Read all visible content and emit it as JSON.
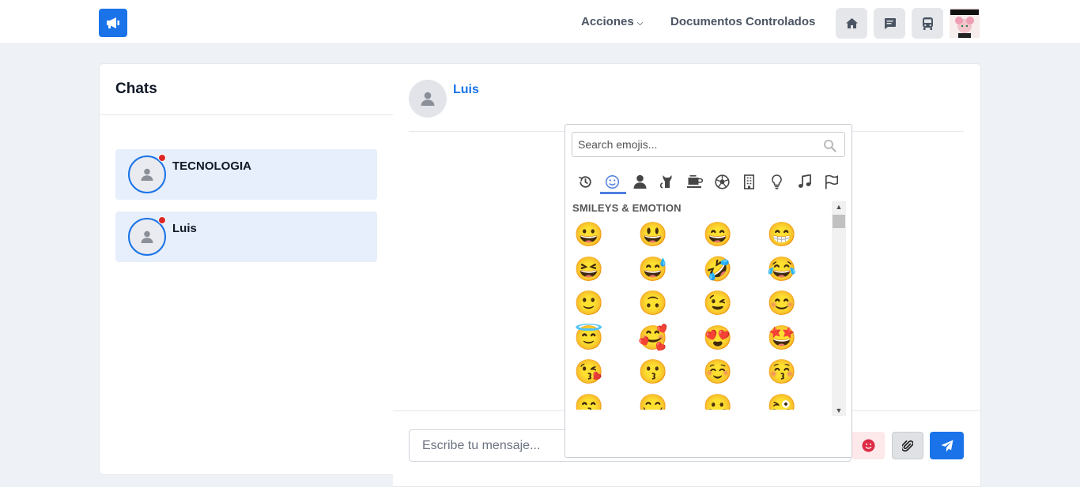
{
  "nav": {
    "acciones": "Acciones",
    "documentos": "Documentos Controlados"
  },
  "chats": {
    "title": "Chats",
    "items": [
      {
        "name": "TECNOLOGIA"
      },
      {
        "name": "Luis"
      }
    ]
  },
  "conversation": {
    "contact_name": "Luis",
    "input_placeholder": "Escribe tu mensaje..."
  },
  "emoji_picker": {
    "search_placeholder": "Search emojis...",
    "categories": [
      "recent",
      "smileys",
      "people",
      "animals",
      "food",
      "activities",
      "travel",
      "objects",
      "symbols",
      "flags"
    ],
    "active_category": "smileys",
    "section_title": "SMILEYS & EMOTION",
    "emojis": [
      "😀",
      "😃",
      "😄",
      "😁",
      "😆",
      "😅",
      "🤣",
      "😂",
      "🙂",
      "🙃",
      "😉",
      "😊",
      "😇",
      "🥰",
      "😍",
      "🤩",
      "😘",
      "😗",
      "☺️",
      "😚",
      "😙",
      "😋",
      "😛",
      "😜"
    ]
  },
  "colors": {
    "primary": "#1a73e8",
    "unread_dot": "#dc2626",
    "chat_item_bg": "#e6effb"
  }
}
